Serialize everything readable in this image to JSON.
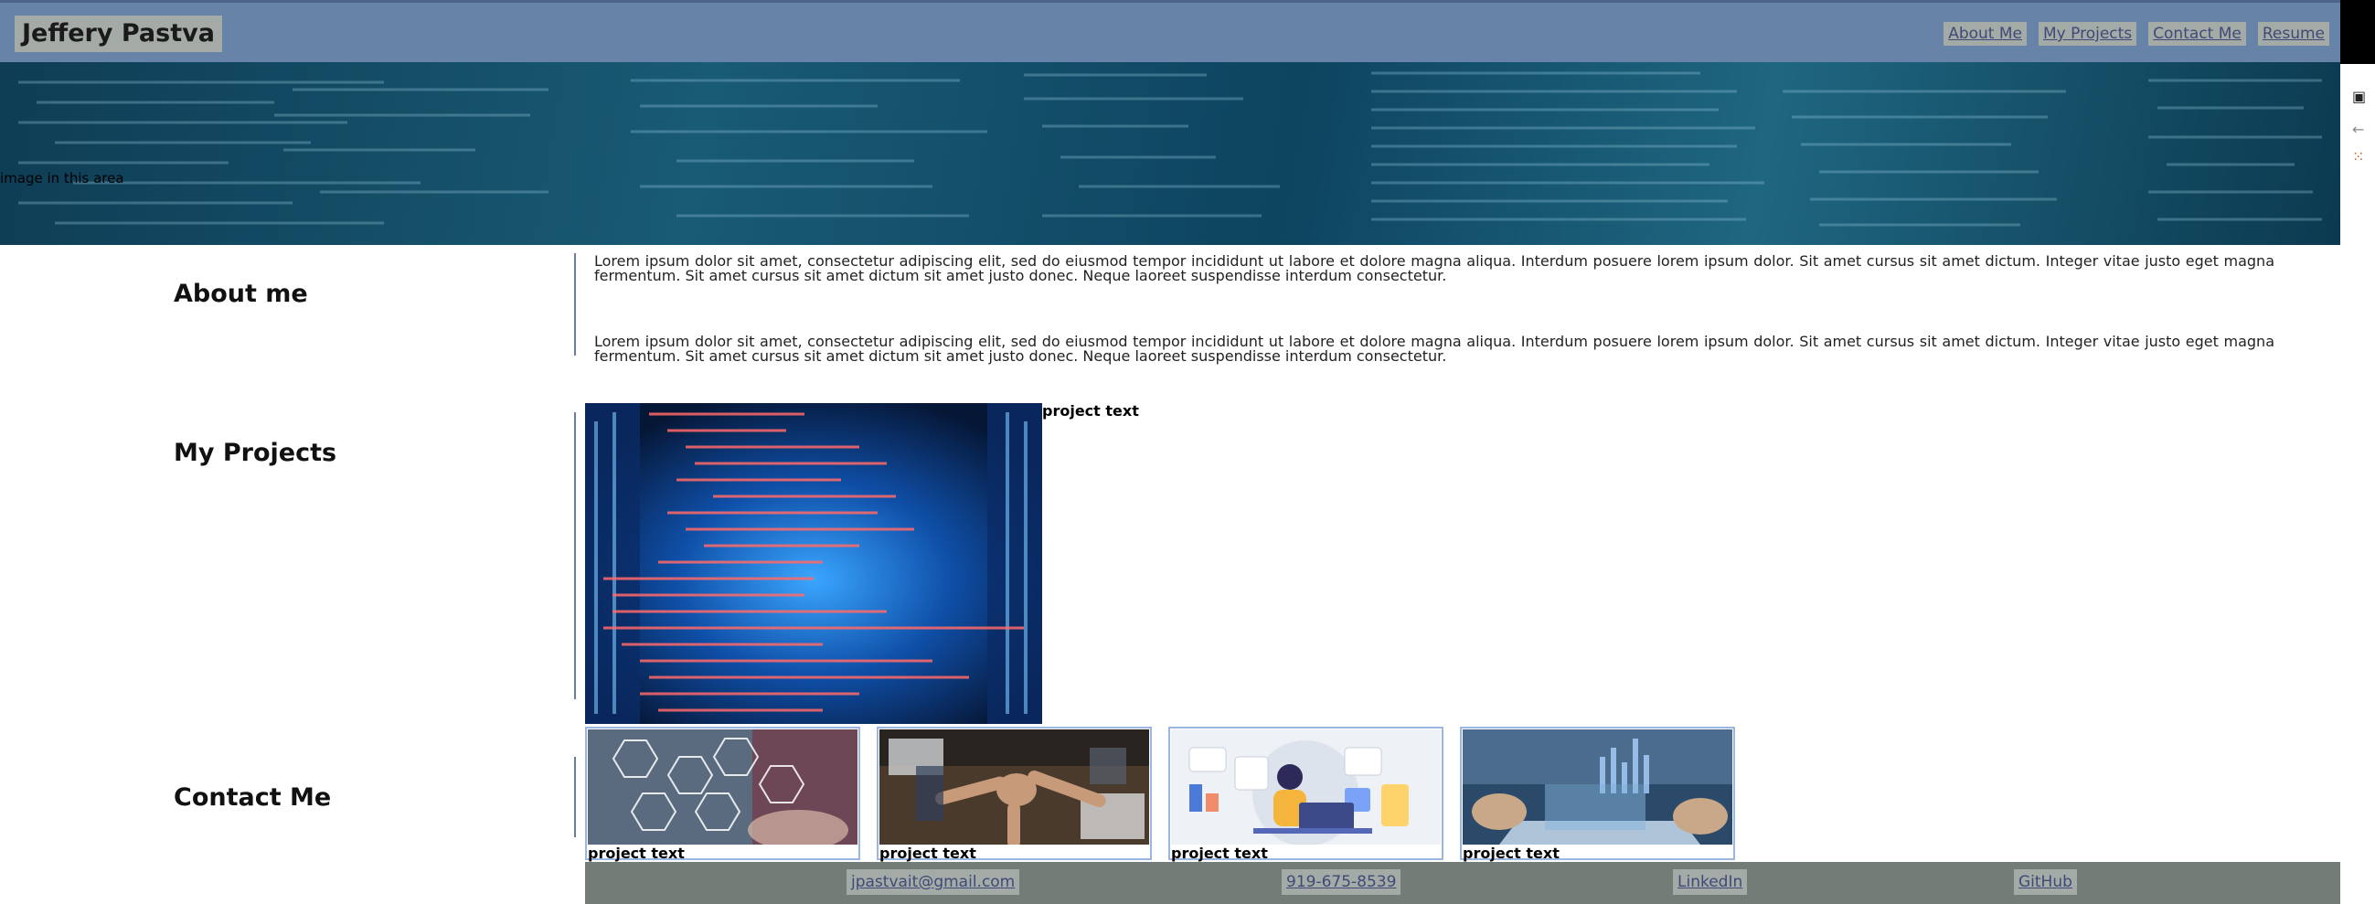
{
  "header": {
    "title": "Jeffery Pastva",
    "nav": [
      "About Me",
      "My Projects",
      "Contact Me",
      "Resume"
    ]
  },
  "hero": {
    "label": "image in this area"
  },
  "about": {
    "title": "About me",
    "paragraphs": [
      "Lorem ipsum dolor sit amet, consectetur adipiscing elit, sed do eiusmod tempor incididunt ut labore et dolore magna aliqua. Interdum posuere lorem ipsum dolor. Sit amet cursus sit amet dictum. Integer vitae justo eget magna fermentum. Sit amet cursus sit amet dictum sit amet justo donec. Neque laoreet suspendisse interdum consectetur.",
      "Lorem ipsum dolor sit amet, consectetur adipiscing elit, sed do eiusmod tempor incididunt ut labore et dolore magna aliqua. Interdum posuere lorem ipsum dolor. Sit amet cursus sit amet dictum. Integer vitae justo eget magna fermentum. Sit amet cursus sit amet dictum sit amet justo donec. Neque laoreet suspendisse interdum consectetur."
    ]
  },
  "projects": {
    "title": "My Projects",
    "featured_text": "project text",
    "cards": [
      {
        "text": "project text"
      },
      {
        "text": "project text"
      },
      {
        "text": "project text"
      },
      {
        "text": "project text"
      }
    ]
  },
  "contact": {
    "title": "Contact Me"
  },
  "footer": {
    "links": [
      "jpastvait@gmail.com",
      "919-675-8539",
      "LinkedIn",
      "GitHub"
    ]
  },
  "colors": {
    "header_bg": "#6883a8",
    "button_bg": "#a4aba6",
    "link": "#3f4a78",
    "footer_bg": "#737c76",
    "card_border": "#9bb6e0"
  }
}
